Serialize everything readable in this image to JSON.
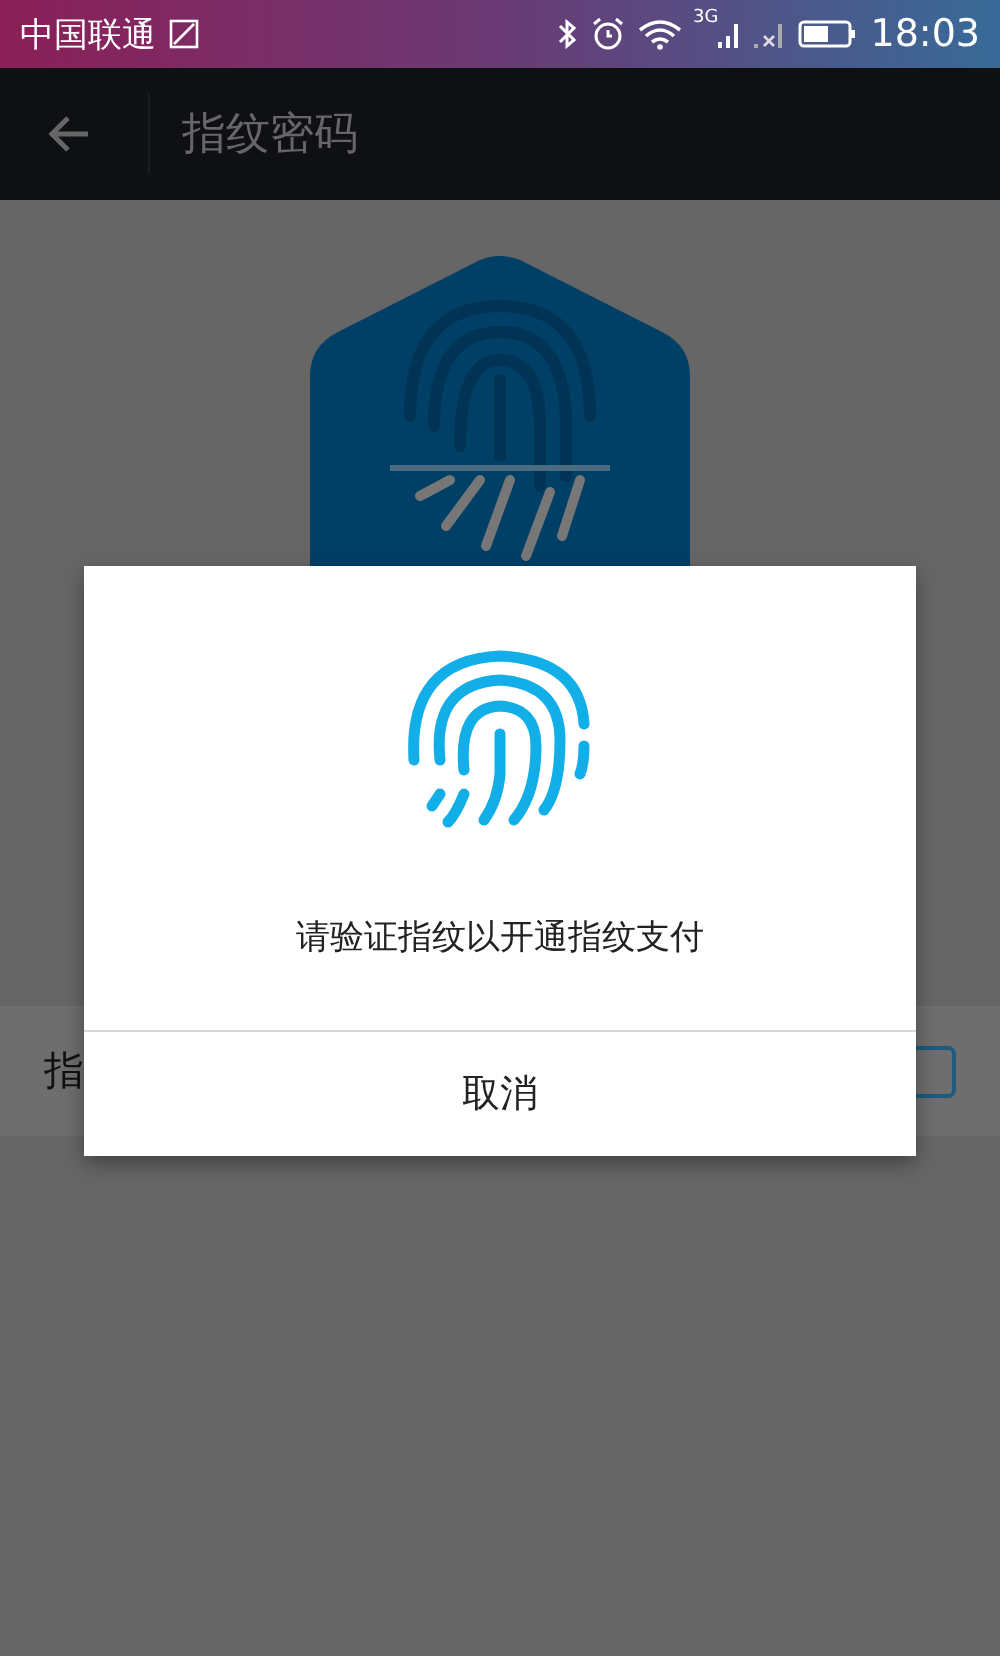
{
  "status_bar": {
    "carrier": "中国联通",
    "network_label": "3G",
    "time": "18:03"
  },
  "app_bar": {
    "title": "指纹密码"
  },
  "setting_row": {
    "label": "指"
  },
  "dialog": {
    "message": "请验证指纹以开通指纹支付",
    "buttons": [
      "取消"
    ]
  }
}
